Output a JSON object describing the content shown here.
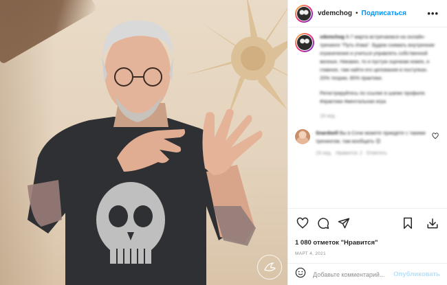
{
  "post": {
    "username": "vdemchog",
    "follow_label": "Подписаться",
    "separator": "•",
    "more_label": "•••"
  },
  "caption": {
    "author": "vdemchog",
    "text_1": "6-7 марта встречаемся на онлайн-тренинге \"Путь Изма\". Будем снимать внутренние ограничения и учиться управлять собственной жизнью. Никаких, то и пустую оценкам ножек, и главное, там найти его целования в поступках. 20% теории, 80% практики.",
    "text_2": "Регистрируйтесь по ссылке в шапке профиля. #практики #ментальная игра",
    "time": "19 нед."
  },
  "comment": {
    "author": "Snardoell",
    "text": "Вы в Сочи можете приедете с такими тренингом, там вообщеть 😊",
    "time": "19 нед.",
    "reply_label": "Ответить",
    "likes": "Нравится: 2"
  },
  "stats": {
    "likes_text": "1 080 отметок \"Нравится\"",
    "date": "МАРТ 4, 2021"
  },
  "comment_input": {
    "placeholder": "Добавьте комментарий...",
    "publish_label": "Опубликовать"
  },
  "colors": {
    "accent": "#0095f6",
    "publish_disabled": "#b2dffc",
    "muted": "#8e8e8e",
    "text": "#262626"
  },
  "icons": [
    "heart-icon",
    "comment-icon",
    "share-icon",
    "bookmark-icon",
    "download-icon",
    "emoji-icon",
    "more-icon"
  ]
}
